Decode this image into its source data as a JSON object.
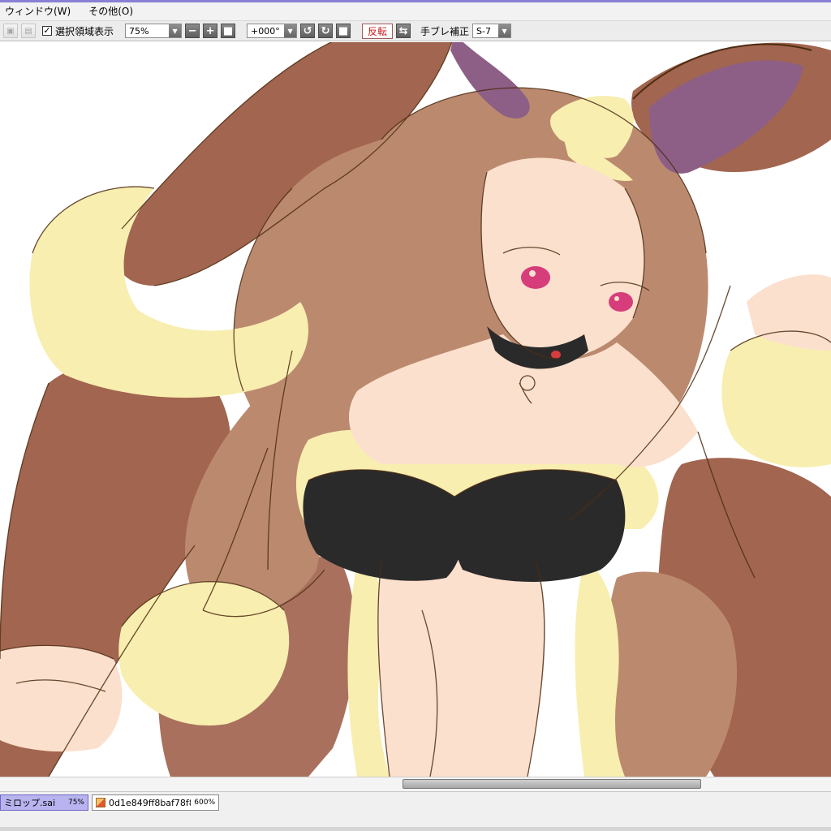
{
  "menubar": {
    "items": [
      "ウィンドウ(W)",
      "その他(O)"
    ]
  },
  "toolbar": {
    "selection_checkbox_checked": true,
    "selection_label": "選択領域表示",
    "zoom_value": "75%",
    "rotation_value": "+000°",
    "flip_label": "反転",
    "stabilizer_label": "手ブレ補正",
    "stabilizer_value": "S-7"
  },
  "tabs": [
    {
      "name": "ミロップ.sai",
      "zoom": "75%",
      "active": true
    },
    {
      "name": "0d1e849ff8baf78f8...",
      "zoom": "600%",
      "active": false
    }
  ],
  "scrollbar": {
    "horizontal_position": 0.66
  },
  "colors": {
    "window_accent": "#8a7fd6",
    "active_tab": "#b9b3ef",
    "flip_text": "#cc1a1a",
    "hair_brown": "#a2654f",
    "hair_light": "#bb8a6e",
    "fur_cream": "#f8eeb0",
    "skin": "#fbe0cd",
    "bra_black": "#2b2a2b",
    "ear_inner": "#8d5f86",
    "eye_pink": "#d63d7a",
    "line_art": "#4e2c12"
  }
}
